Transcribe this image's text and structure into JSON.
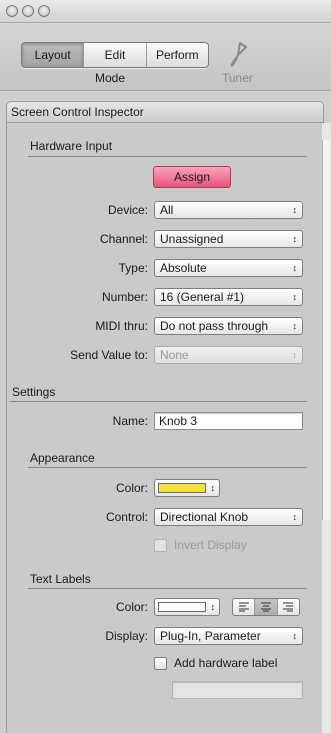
{
  "toolbar": {
    "mode_tabs": [
      "Layout",
      "Edit",
      "Perform"
    ],
    "active_tab": "Layout",
    "mode_label": "Mode",
    "tuner_label": "Tuner"
  },
  "inspector": {
    "title": "Screen Control Inspector",
    "hardware_input": {
      "section_title": "Hardware Input",
      "assign_label": "Assign",
      "device_label": "Device:",
      "device_value": "All",
      "channel_label": "Channel:",
      "channel_value": "Unassigned",
      "type_label": "Type:",
      "type_value": "Absolute",
      "number_label": "Number:",
      "number_value": "16 (General #1)",
      "midi_thru_label": "MIDI thru:",
      "midi_thru_value": "Do not pass through",
      "send_value_label": "Send Value to:",
      "send_value_value": "None"
    },
    "settings": {
      "section_title": "Settings",
      "name_label": "Name:",
      "name_value": "Knob 3"
    },
    "appearance": {
      "section_title": "Appearance",
      "color_label": "Color:",
      "color_hex": "#f3e13a",
      "control_label": "Control:",
      "control_value": "Directional Knob",
      "invert_label": "Invert Display"
    },
    "text_labels": {
      "section_title": "Text Labels",
      "color_label": "Color:",
      "color_hex": "#ffffff",
      "display_label": "Display:",
      "display_value": "Plug-In, Parameter",
      "add_hw_label": "Add hardware label",
      "hw_label_value": ""
    }
  },
  "colors": {
    "assign_button": "#ef7496",
    "panel": "#cacaca"
  }
}
